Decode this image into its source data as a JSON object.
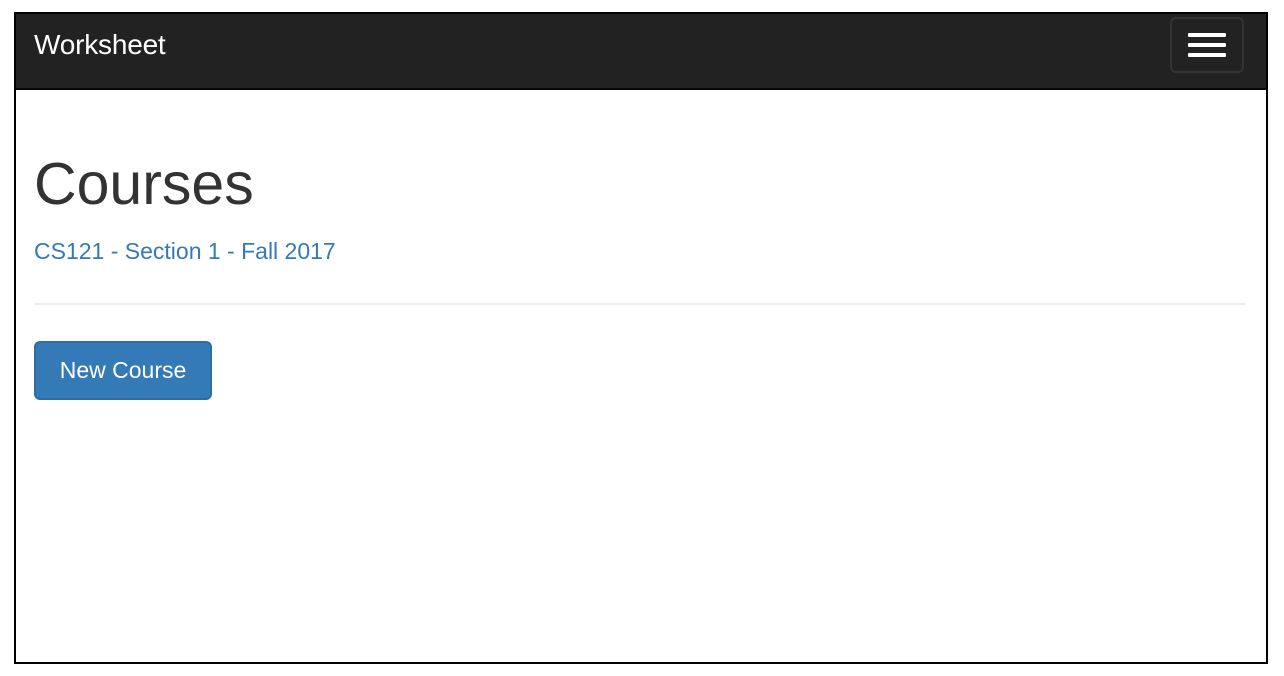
{
  "navbar": {
    "brand": "Worksheet",
    "menu_icon": "hamburger-menu-icon"
  },
  "main": {
    "title": "Courses",
    "courses": [
      {
        "label": "CS121 - Section 1 - Fall 2017"
      }
    ],
    "new_course_label": "New Course"
  },
  "colors": {
    "navbar_bg": "#222222",
    "link": "#337ab7",
    "primary_button": "#337ab7",
    "heading": "#333333"
  }
}
